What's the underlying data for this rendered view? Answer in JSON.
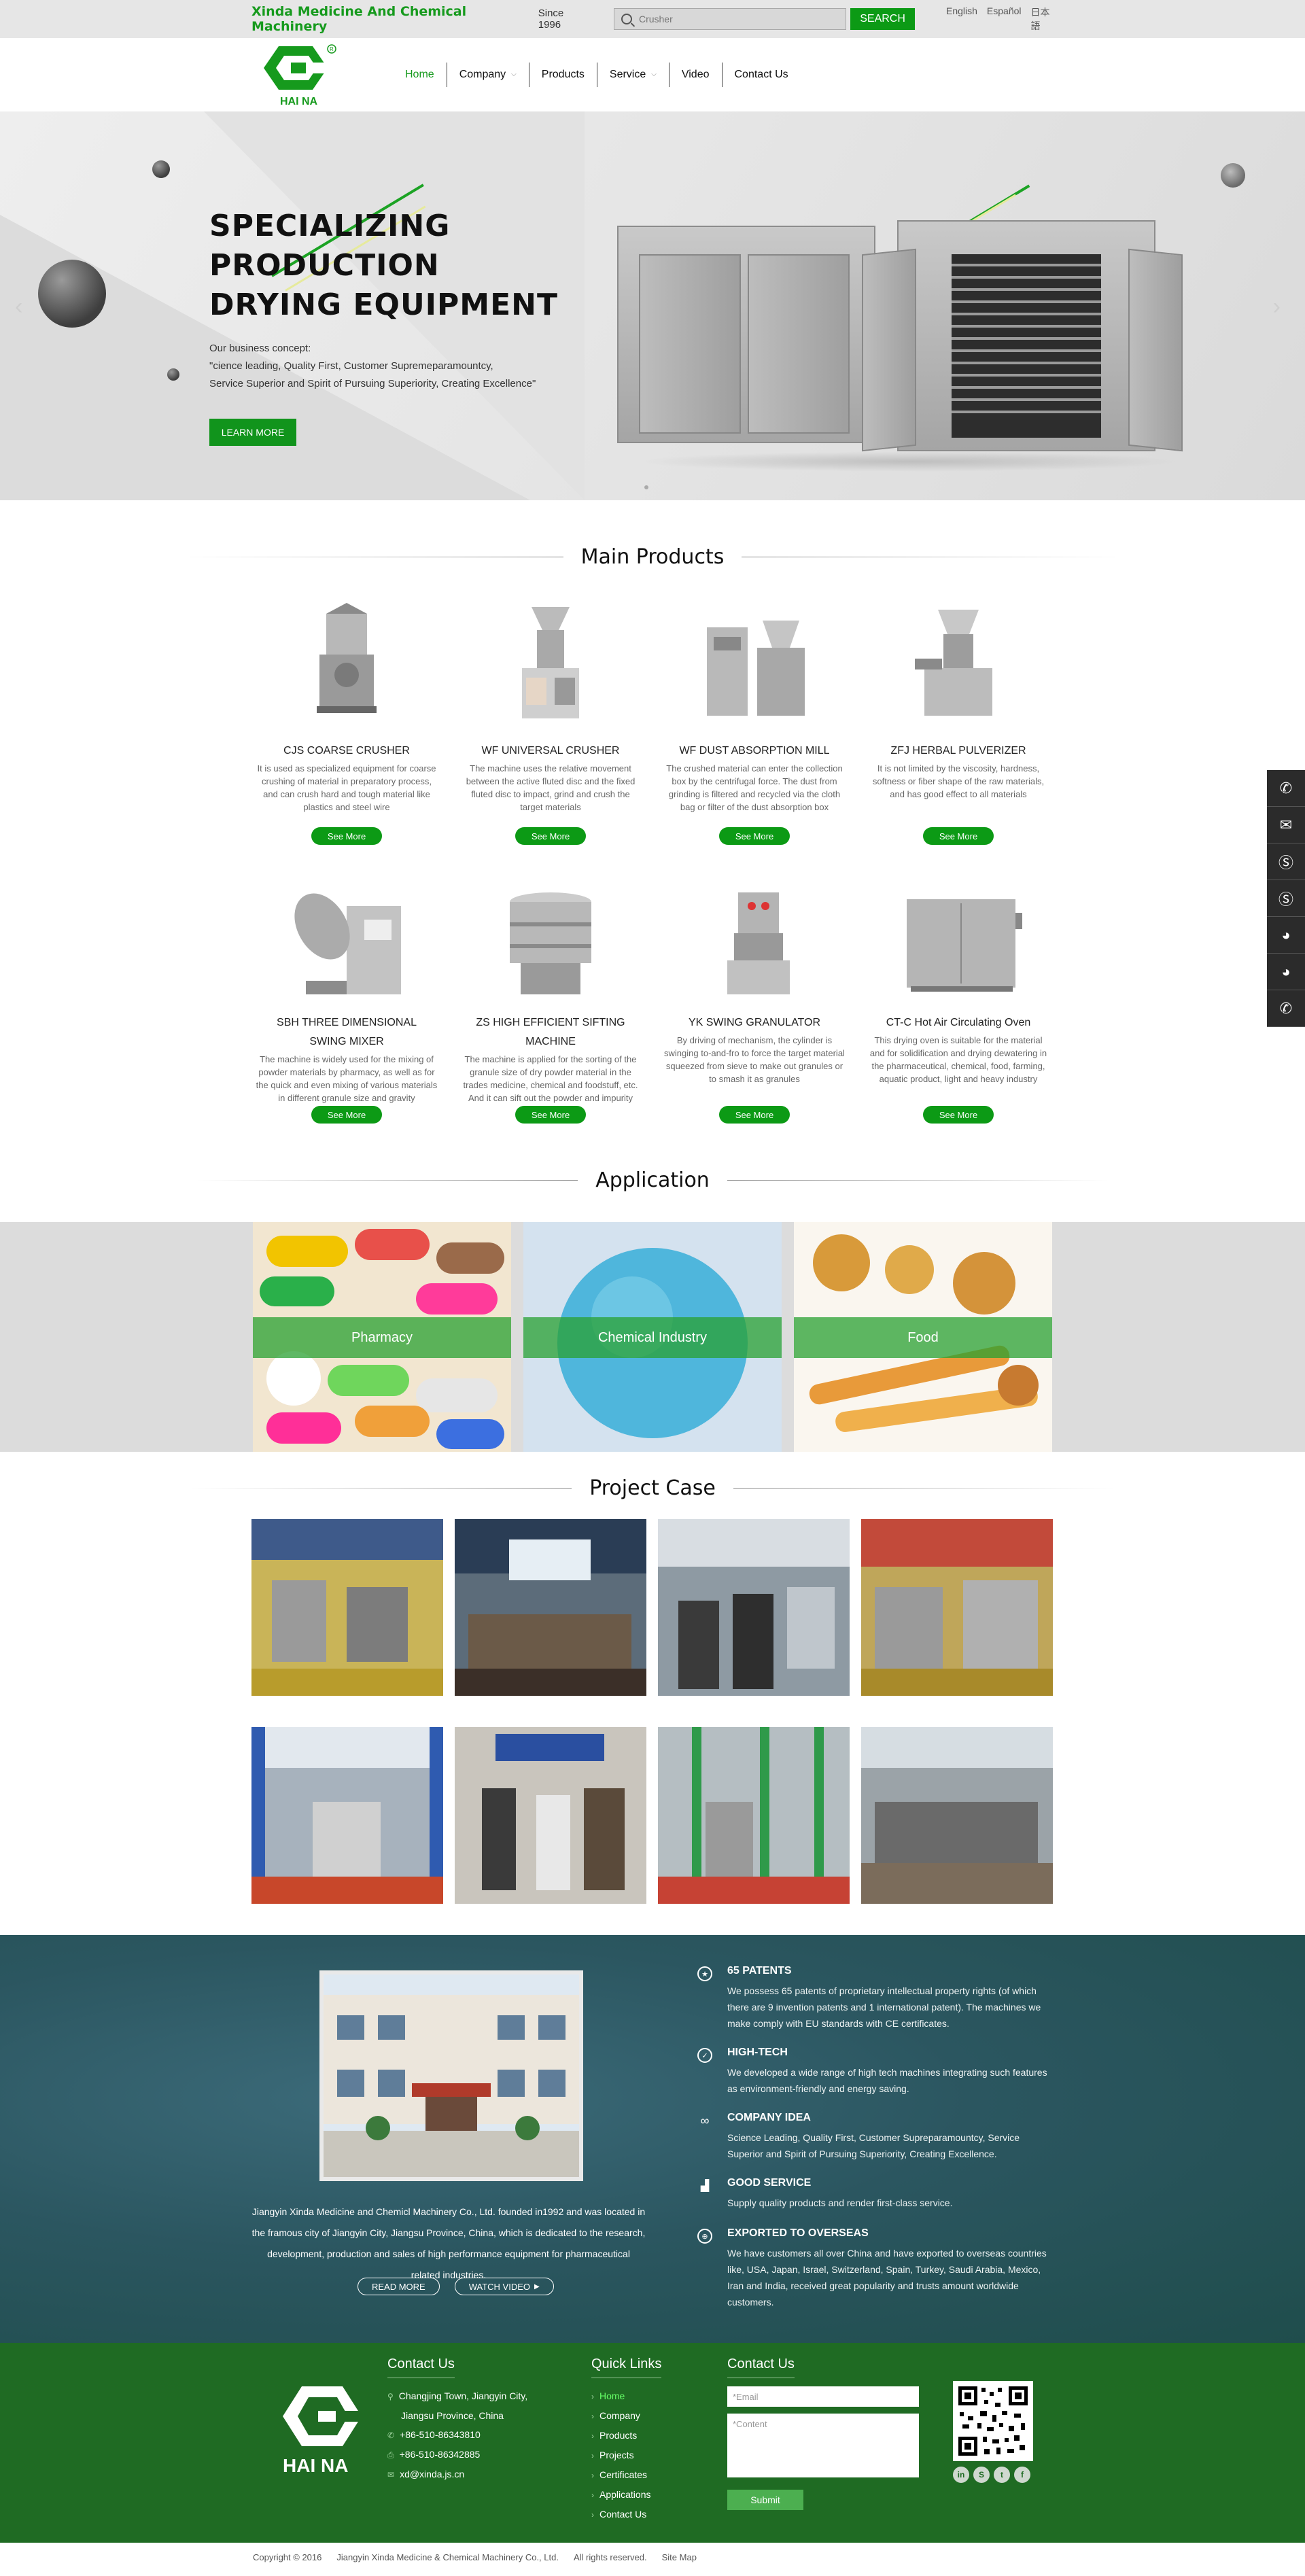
{
  "topbar": {
    "company_name": "Xinda Medicine And Chemical Machinery",
    "since": "Since 1996",
    "search_placeholder": "Crusher",
    "search_button": "SEARCH",
    "languages": [
      "English",
      "Español",
      "日本語"
    ]
  },
  "header": {
    "logo_text": "HAI NA",
    "nav": [
      {
        "label": "Home",
        "active": true,
        "dropdown": false
      },
      {
        "label": "Company",
        "active": false,
        "dropdown": true
      },
      {
        "label": "Products",
        "active": false,
        "dropdown": false
      },
      {
        "label": "Service",
        "active": false,
        "dropdown": true
      },
      {
        "label": "Video",
        "active": false,
        "dropdown": false
      },
      {
        "label": "Contact Us",
        "active": false,
        "dropdown": false
      }
    ]
  },
  "banner": {
    "headline_1": "SPECIALIZING",
    "headline_2": "PRODUCTION",
    "headline_3": "DRYING EQUIPMENT",
    "concept_label": "Our business concept:",
    "concept_line_1": "\"cience leading, Quality First, Customer Supremeparamountcy,",
    "concept_line_2": "Service Superior and Spirit of Pursuing Superiority, Creating Excellence\"",
    "button": "LEARN MORE",
    "prev_arrow": "‹",
    "next_arrow": "›"
  },
  "products": {
    "title": "Main Products",
    "see_more": "See More",
    "items": [
      {
        "name": "CJS COARSE CRUSHER",
        "desc": "It is used as specialized equipment for coarse crushing of material in preparatory process, and can crush hard and tough material like plastics and steel wire"
      },
      {
        "name": "WF UNIVERSAL CRUSHER",
        "desc": "The machine uses the relative movement between the active fluted disc and the fixed fluted disc to impact, grind and crush the target materials"
      },
      {
        "name": "WF DUST ABSORPTION MILL",
        "desc": "The crushed material can enter the collection box by the centrifugal force. The dust from grinding is filtered and recycled via the cloth bag or filter of the dust absorption box"
      },
      {
        "name": "ZFJ HERBAL PULVERIZER",
        "desc": "It is not limited by the viscosity, hardness, softness or fiber shape of the raw materials, and has good effect to all materials"
      },
      {
        "name": "SBH THREE DIMENSIONAL SWING MIXER",
        "desc": "The machine is widely used for the mixing of powder materials by pharmacy, as well as for the quick and even mixing of various materials in different granule size and gravity"
      },
      {
        "name": "ZS HIGH EFFICIENT SIFTING MACHINE",
        "desc": "The machine is applied for the sorting of the granule size of dry powder material in the trades medicine, chemical and foodstuff, etc. And it can sift out the powder and impurity"
      },
      {
        "name": "YK SWING GRANULATOR",
        "desc": "By driving of mechanism, the cylinder is swinging to-and-fro to force the target material squeezed from sieve to make out granules or to smash it as granules"
      },
      {
        "name": "CT-C Hot Air Circulating Oven",
        "desc": "This drying oven is suitable for the material and for solidification and drying dewatering in the pharmaceutical, chemical, food, farming, aquatic product, light and heavy industry"
      }
    ]
  },
  "application": {
    "title": "Application",
    "items": [
      "Pharmacy",
      "Chemical Industry",
      "Food"
    ]
  },
  "project": {
    "title": "Project Case"
  },
  "about": {
    "intro": "Jiangyin Xinda Medicine and Chemicl Machinery Co., Ltd. founded in1992 and was located in the framous city of Jiangyin City, Jiangsu Province, China, which is dedicated to the research, development, production and sales of high performance equipment for pharmaceutical related industries.",
    "read_more": "READ MORE",
    "watch_video": "WATCH VIDEO",
    "features": [
      {
        "title": "65 PATENTS",
        "text": "We possess 65 patents of proprietary intellectual property rights (of which there are 9 invention patents and 1 international patent). The machines we make comply with EU standards with CE certificates."
      },
      {
        "title": "HIGH-TECH",
        "text": "We developed a wide range of high tech machines integrating such features as environment-friendly and energy saving."
      },
      {
        "title": "COMPANY IDEA",
        "text": "Science Leading, Quality First, Customer Supreparamountcy, Service Superior and Spirit of Pursuing Superiority, Creating Excellence."
      },
      {
        "title": "GOOD SERVICE",
        "text": "Supply quality products and render first-class service."
      },
      {
        "title": "EXPORTED TO OVERSEAS",
        "text": "We have customers all over China and have exported to overseas countries like, USA, Japan, Israel, Switzerland, Spain, Turkey, Saudi Arabia, Mexico, Iran and India, received great popularity and trusts amount worldwide customers."
      }
    ]
  },
  "footer": {
    "logo_text": "HAI NA",
    "contact_title": "Contact Us",
    "address_1": "Changjing Town, Jiangyin City,",
    "address_2": "Jiangsu Province, China",
    "phone": "+86-510-86343810",
    "fax": "+86-510-86342885",
    "email": "xd@xinda.js.cn",
    "links_title": "Quick Links",
    "links": [
      "Home",
      "Company",
      "Products",
      "Projects",
      "Certificates",
      "Applications",
      "Contact Us"
    ],
    "form_title": "Contact Us",
    "email_placeholder": "*Email",
    "content_placeholder": "*Content",
    "submit": "Submit",
    "copyright": "Copyright ©  2016",
    "company": "Jiangyin Xinda Medicine & Chemical Machinery Co., Ltd.",
    "rights": "All rights reserved.",
    "sitemap": "Site Map"
  },
  "colors": {
    "brand_green": "#169a1d",
    "footer_green": "#1f6b23",
    "about_teal": "#2b5660"
  },
  "sidebar_icons": [
    "phone-icon",
    "mail-icon",
    "skype-icon",
    "skype-icon",
    "qq-icon",
    "qq-icon",
    "phone-icon"
  ]
}
